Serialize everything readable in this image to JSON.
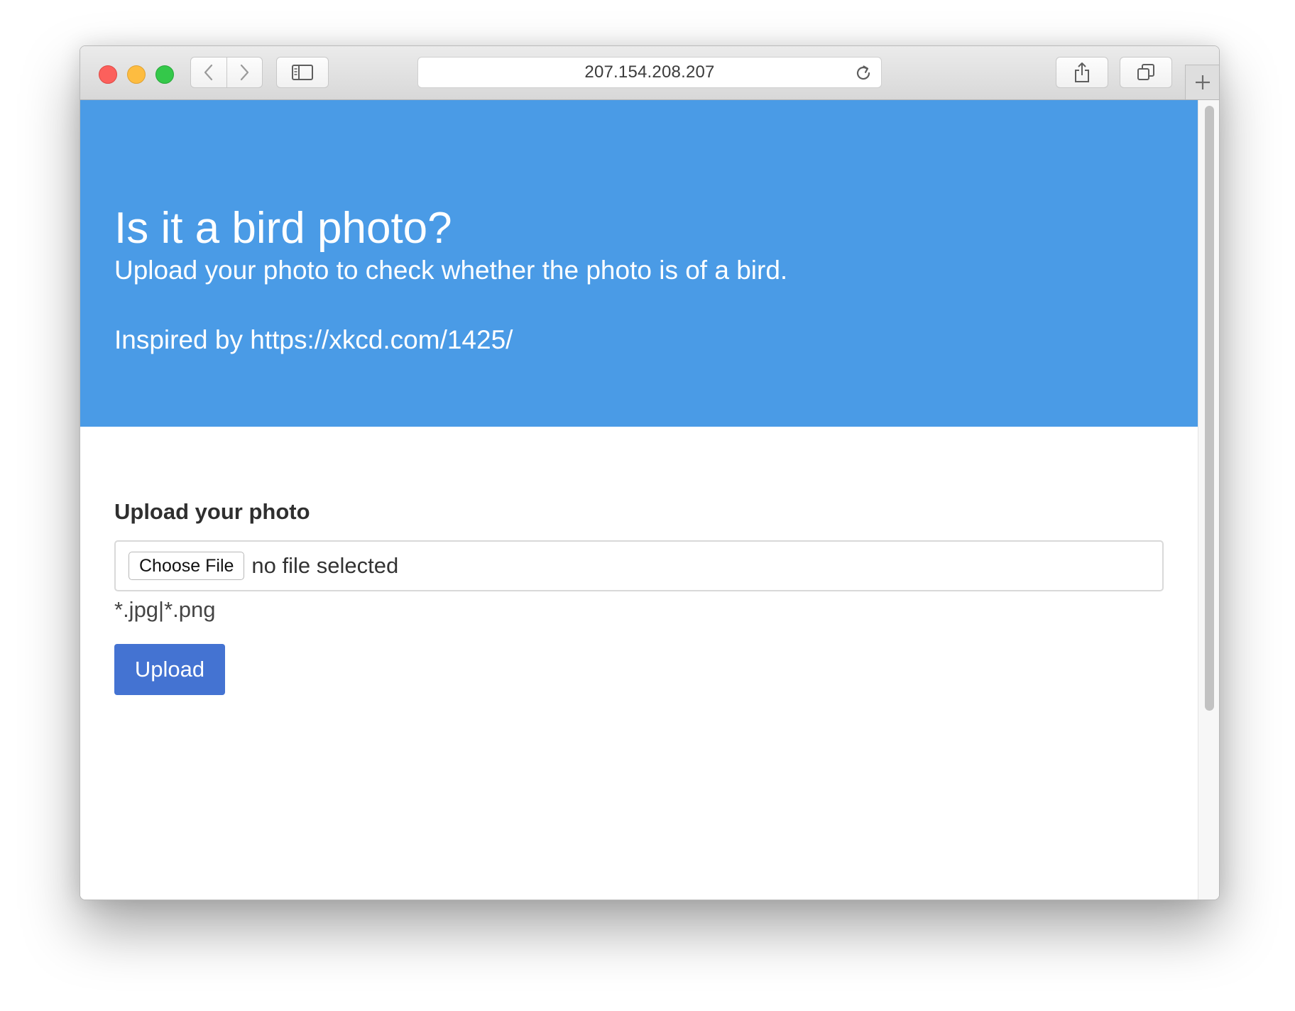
{
  "browser": {
    "url": "207.154.208.207",
    "icons": {
      "back": "chevron-left-icon",
      "forward": "chevron-right-icon",
      "sidebar": "sidebar-icon",
      "reload": "reload-icon",
      "share": "share-icon",
      "tabs": "tabs-overview-icon",
      "new_tab": "plus-icon"
    }
  },
  "hero": {
    "title": "Is it a bird photo?",
    "subtitle": "Upload your photo to check whether the photo is of a bird.",
    "inspired": "Inspired by https://xkcd.com/1425/",
    "background_color": "#4a9be6"
  },
  "form": {
    "label": "Upload your photo",
    "choose_file_label": "Choose File",
    "file_status": "no file selected",
    "accept_hint": "*.jpg|*.png",
    "upload_label": "Upload",
    "upload_color": "#4473d2"
  }
}
